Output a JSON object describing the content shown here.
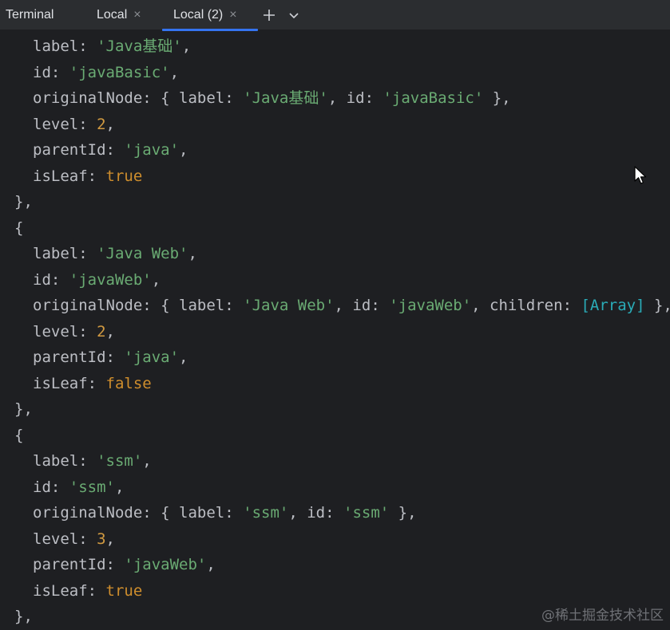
{
  "tabbar": {
    "title": "Terminal",
    "tabs": [
      {
        "label": "Local",
        "active": false
      },
      {
        "label": "Local (2)",
        "active": true
      }
    ],
    "add_icon": "plus-icon",
    "more_icon": "chevron-down-icon",
    "close_glyph": "×"
  },
  "colors": {
    "background": "#1e1f22",
    "tabbar": "#2b2d30",
    "active_tab_underline": "#3574f0",
    "string": "#6aab73",
    "number": "#d19a41",
    "keyword": "#cf8e2d",
    "array_ref": "#2aacb8",
    "text": "#bcbec4"
  },
  "terminal": {
    "lines": [
      {
        "key": "label",
        "sep": ": ",
        "val": "'Java基础'",
        "tail": ","
      },
      {
        "key": "id",
        "sep": ": ",
        "val": "'javaBasic'",
        "tail": ","
      },
      {
        "key": "originalNode",
        "sep": ": { ",
        "k2": "label",
        "sep2": ": ",
        "v2": "'Java基础'",
        "sep3": ", ",
        "k3": "id",
        "sep4": ": ",
        "v3": "'javaBasic'",
        "tail": " },"
      },
      {
        "key": "level",
        "sep": ": ",
        "val": "2",
        "tail": ","
      },
      {
        "key": "parentId",
        "sep": ": ",
        "val": "'java'",
        "tail": ","
      },
      {
        "key": "isLeaf",
        "sep": ": ",
        "val": "true",
        "tail": ""
      },
      {
        "text": "},"
      },
      {
        "text": "{"
      },
      {
        "key": "label",
        "sep": ": ",
        "val": "'Java Web'",
        "tail": ","
      },
      {
        "key": "id",
        "sep": ": ",
        "val": "'javaWeb'",
        "tail": ","
      },
      {
        "key": "originalNode",
        "sep": ": { ",
        "k2": "label",
        "sep2": ": ",
        "v2": "'Java Web'",
        "sep3": ", ",
        "k3": "id",
        "sep4": ": ",
        "v3": "'javaWeb'",
        "sep5": ", ",
        "k4": "children",
        "sep6": ": ",
        "v4": "[Array]",
        "tail": " },"
      },
      {
        "key": "level",
        "sep": ": ",
        "val": "2",
        "tail": ","
      },
      {
        "key": "parentId",
        "sep": ": ",
        "val": "'java'",
        "tail": ","
      },
      {
        "key": "isLeaf",
        "sep": ": ",
        "val": "false",
        "tail": ""
      },
      {
        "text": "},"
      },
      {
        "text": "{"
      },
      {
        "key": "label",
        "sep": ": ",
        "val": "'ssm'",
        "tail": ","
      },
      {
        "key": "id",
        "sep": ": ",
        "val": "'ssm'",
        "tail": ","
      },
      {
        "key": "originalNode",
        "sep": ": { ",
        "k2": "label",
        "sep2": ": ",
        "v2": "'ssm'",
        "sep3": ", ",
        "k3": "id",
        "sep4": ": ",
        "v3": "'ssm'",
        "tail": " },"
      },
      {
        "key": "level",
        "sep": ": ",
        "val": "3",
        "tail": ","
      },
      {
        "key": "parentId",
        "sep": ": ",
        "val": "'javaWeb'",
        "tail": ","
      },
      {
        "key": "isLeaf",
        "sep": ": ",
        "val": "true",
        "tail": ""
      },
      {
        "text": "},"
      }
    ]
  },
  "watermark": "@稀土掘金技术社区",
  "cursor_icon": "mouse-pointer-icon"
}
